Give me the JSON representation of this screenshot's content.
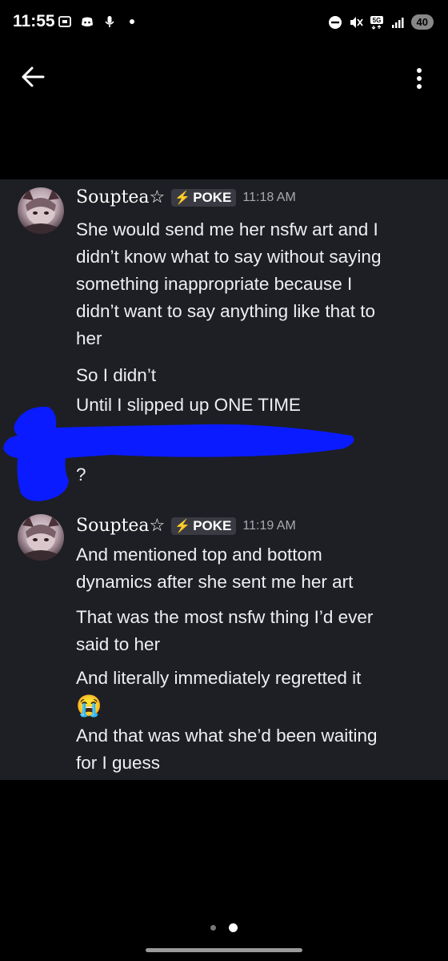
{
  "status_bar": {
    "time": "11:55",
    "battery": "40",
    "network": "5G"
  },
  "top_bar": {
    "back_icon": "arrow-left-icon",
    "more_icon": "more-vertical-icon"
  },
  "messages": [
    {
      "username": "Souptea☆",
      "tag": "POKE",
      "tag_icon": "lightning-bolt-icon",
      "timestamp": "11:18 AM",
      "lines": [
        "She would send me her nsfw art and I",
        "didn’t know what to say without saying",
        "something inappropriate because I",
        "didn’t want to say anything like that to",
        "her",
        "So I didn’t",
        "Until I slipped up ONE TIME"
      ]
    },
    {
      "lines": [
        "?"
      ]
    },
    {
      "username": "Souptea☆",
      "tag": "POKE",
      "tag_icon": "lightning-bolt-icon",
      "timestamp": "11:19 AM",
      "lines": [
        "And mentioned top and bottom",
        "dynamics after she sent me her art",
        "That was the most nsfw thing I’d ever",
        "said to her",
        "And literally immediately regretted it",
        "😭",
        "And that was what she’d been waiting",
        "for I guess"
      ]
    }
  ],
  "colors": {
    "chat_background": "#1e1f24",
    "redaction": "#0a1bff",
    "tag_bolt": "#c586f2"
  }
}
